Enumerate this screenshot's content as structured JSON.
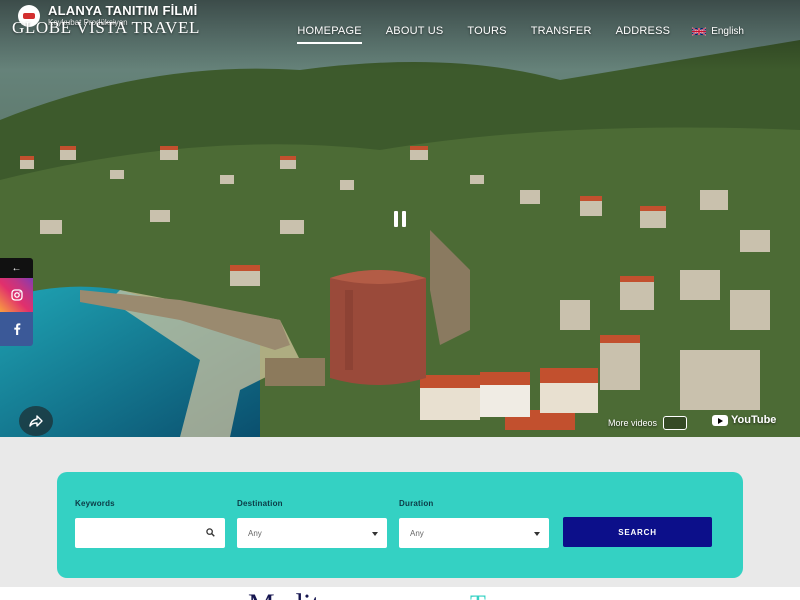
{
  "video": {
    "title": "ALANYA TANITIM FİLMİ",
    "channel": "Keykubat Prodüksiyon",
    "more_videos_label": "More videos",
    "youtube_label": "YouTube"
  },
  "brand": {
    "name": "GLOBE VISTA TRAVEL"
  },
  "nav": {
    "items": [
      {
        "label": "HOMEPAGE",
        "active": true
      },
      {
        "label": "ABOUT US",
        "active": false
      },
      {
        "label": "TOURS",
        "active": false
      },
      {
        "label": "TRANSFER",
        "active": false
      },
      {
        "label": "ADDRESS",
        "active": false
      }
    ],
    "language": "English"
  },
  "social": {
    "toggle": "←"
  },
  "search": {
    "keywords_label": "Keywords",
    "keywords_value": "",
    "destination_label": "Destination",
    "destination_value": "Any",
    "duration_label": "Duration",
    "duration_value": "Any",
    "button_label": "SEARCH"
  },
  "bottom": {
    "heading": "Medit",
    "accent": "T"
  },
  "colors": {
    "accent": "#34d1c3",
    "search_button": "#0c0f8a",
    "section_bg": "#e9e9e9",
    "heading": "#15154f"
  }
}
